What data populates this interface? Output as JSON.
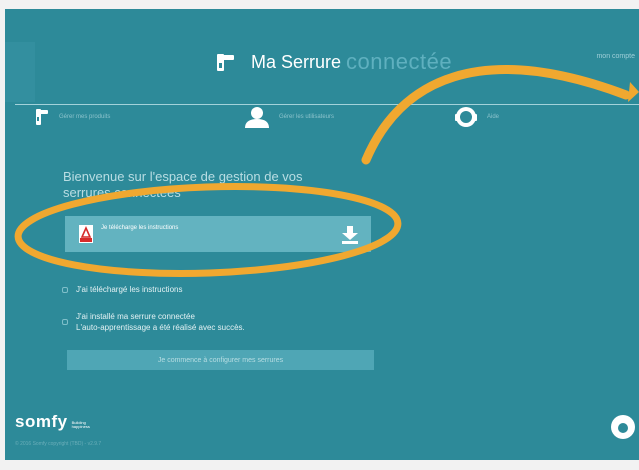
{
  "header": {
    "title_main": "Ma Serrure",
    "title_accent": "connectée",
    "account_link": "mon compte"
  },
  "nav": {
    "items": [
      {
        "label": "Gérer mes produits",
        "icon": "lock-handle-icon"
      },
      {
        "label": "Gérer les utilisateurs",
        "icon": "user-icon"
      },
      {
        "label": "Aide",
        "icon": "help-headset-icon"
      }
    ]
  },
  "main": {
    "welcome": "Bienvenue sur l'espace de gestion de vos serrures connectées",
    "download": {
      "label": "Je télécharge les instructions",
      "pdf_tag": "PDF",
      "icon": "download-icon"
    },
    "checks": [
      {
        "text_lines": [
          "J'ai téléchargé les instructions"
        ]
      },
      {
        "text_lines": [
          "J'ai installé ma serrure connectée",
          "L'auto-apprentissage a été réalisé avec succès."
        ]
      }
    ],
    "config_button": "Je commence à configurer mes serrures"
  },
  "footer": {
    "logo_word": "somfy",
    "logo_tag_line1": "Building",
    "logo_tag_line2": "happiness",
    "copyright": "© 2016 Somfy copyright (TBD) - v2.9.7"
  },
  "colors": {
    "background": "#2d8a99",
    "download_box": "#63b3c0",
    "button": "#4fa6b5",
    "annotation": "#f0a830"
  }
}
